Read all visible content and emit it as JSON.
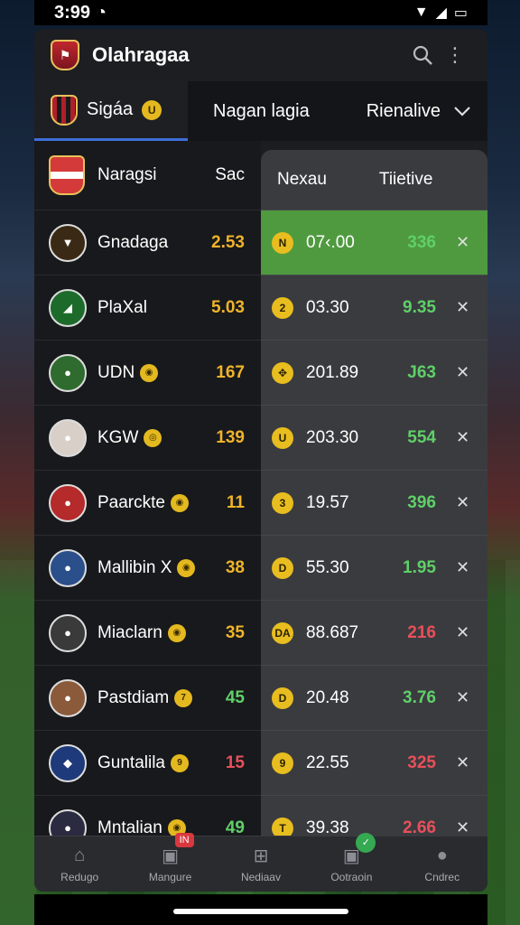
{
  "status": {
    "time": "3:99",
    "icons": "wifi signal battery"
  },
  "header": {
    "title": "Olahragaa",
    "search_icon": "search-icon",
    "more_icon": "more-icon"
  },
  "tabs": {
    "league": "Sigáa",
    "league_badge": "U",
    "middle": "Nagan lagia",
    "right": "Rienalive"
  },
  "left_header": {
    "name": "Naragsi",
    "col": "Sac"
  },
  "right_header": {
    "col1": "Nexau",
    "col2": "Tiietive"
  },
  "players": [
    {
      "name": "Gnadaga",
      "badge": "",
      "value": "2.53",
      "color": "gold",
      "avatar_bg": "#3a2a15",
      "avatar_text": "▼"
    },
    {
      "name": "PlaXal",
      "badge": "",
      "value": "5.03",
      "color": "gold",
      "avatar_bg": "#1d6b2a",
      "avatar_text": "◢"
    },
    {
      "name": "UDN",
      "badge": "◉",
      "value": "167",
      "color": "gold",
      "avatar_bg": "#2f6b2f",
      "avatar_text": "●"
    },
    {
      "name": "KGW",
      "badge": "◎",
      "value": "139",
      "color": "gold",
      "avatar_bg": "#d8d0c8",
      "avatar_text": "●"
    },
    {
      "name": "Paarckte",
      "badge": "◉",
      "value": "11",
      "color": "gold",
      "avatar_bg": "#b52a2a",
      "avatar_text": "●"
    },
    {
      "name": "Mallibin X",
      "badge": "◉",
      "value": "38",
      "color": "gold",
      "avatar_bg": "#2a4f8a",
      "avatar_text": "●"
    },
    {
      "name": "Miaclarn",
      "badge": "◉",
      "value": "35",
      "color": "gold",
      "avatar_bg": "#3a3a3a",
      "avatar_text": "●"
    },
    {
      "name": "Pastdiam",
      "badge": "7",
      "value": "45",
      "color": "green",
      "avatar_bg": "#8a5a3a",
      "avatar_text": "●"
    },
    {
      "name": "Guntalila",
      "badge": "9",
      "value": "15",
      "color": "red",
      "avatar_bg": "#1e3a7a",
      "avatar_text": "◆"
    },
    {
      "name": "Mntalian",
      "badge": "◉",
      "value": "49",
      "color": "green",
      "avatar_bg": "#2a2a40",
      "avatar_text": "●"
    }
  ],
  "right_rows": [
    {
      "coin": "N",
      "value": "07‹.00",
      "num": "336",
      "color": "green",
      "active": true
    },
    {
      "coin": "2",
      "value": "03.30",
      "num": "9.35",
      "color": "green",
      "active": false
    },
    {
      "coin": "✥",
      "value": "201.89",
      "num": "J63",
      "color": "green",
      "active": false
    },
    {
      "coin": "U",
      "value": "203.30",
      "num": "554",
      "color": "green",
      "active": false
    },
    {
      "coin": "3",
      "value": "19.57",
      "num": "396",
      "color": "green",
      "active": false
    },
    {
      "coin": "D",
      "value": "55.30",
      "num": "1.95",
      "color": "green",
      "active": false
    },
    {
      "coin": "DA",
      "value": "88.687",
      "num": "216",
      "color": "red",
      "active": false
    },
    {
      "coin": "D",
      "value": "20.48",
      "num": "3.76",
      "color": "green",
      "active": false
    },
    {
      "coin": "9",
      "value": "22.55",
      "num": "325",
      "color": "red",
      "active": false
    },
    {
      "coin": "T",
      "value": "39.38",
      "num": "2.66",
      "color": "red",
      "active": false
    }
  ],
  "nav": [
    {
      "label": "Redugo",
      "icon": "home-icon",
      "glyph": "⌂",
      "badge": ""
    },
    {
      "label": "Mangure",
      "icon": "cube-icon",
      "glyph": "▣",
      "badge": "IN"
    },
    {
      "label": "Nediaav",
      "icon": "grid-icon",
      "glyph": "⊞",
      "badge": ""
    },
    {
      "label": "Ootraoin",
      "icon": "box-icon",
      "glyph": "▣",
      "badge": "✓"
    },
    {
      "label": "Cndrec",
      "icon": "profile-icon",
      "glyph": "●",
      "badge": ""
    }
  ]
}
